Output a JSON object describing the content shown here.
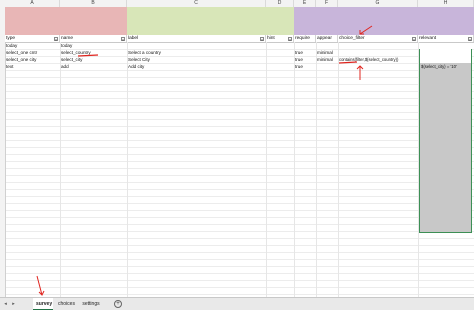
{
  "columns": [
    "A",
    "B",
    "C",
    "D",
    "E",
    "F",
    "G",
    "H"
  ],
  "colors": {
    "band_pink": "#e8b6b6",
    "band_green": "#d8e6b8",
    "band_purple": "#c8b5da",
    "annotation_red": "#e0251f",
    "active_tab_underline": "#217346",
    "selection_border": "#3c8f55"
  },
  "headers": {
    "type": "type",
    "name": "name",
    "label": "label",
    "hint": "hint",
    "required": "require",
    "appearance": "appear",
    "choice_filter": "choice_filter",
    "relevant": "relevant"
  },
  "rows": [
    {
      "type": "today",
      "name": "today",
      "label": "",
      "hint": "",
      "required": "",
      "appearance": "",
      "choice_filter": "",
      "relevant": ""
    },
    {
      "type": "select_one cntr",
      "name": "select_country",
      "label": "Select a country",
      "hint": "",
      "required": "true",
      "appearance": "minimal",
      "choice_filter": "",
      "relevant": ""
    },
    {
      "type": "select_one city",
      "name": "select_city",
      "label": "Select City",
      "hint": "",
      "required": "true",
      "appearance": "minimal",
      "choice_filter": "contains(filter,${select_country})",
      "relevant": "${select_city} = '10'"
    },
    {
      "type": "text",
      "name": "add",
      "label": "Add city",
      "hint": "",
      "required": "true",
      "appearance": "",
      "choice_filter": "",
      "relevant": ""
    }
  ],
  "tabs": [
    "survey",
    "choices",
    "settings"
  ],
  "active_tab": "survey",
  "icons": {
    "filter": "filter-dropdown-icon",
    "nav_prev": "nav-prev-icon",
    "nav_next": "nav-next-icon",
    "add_sheet": "add-sheet-icon"
  }
}
